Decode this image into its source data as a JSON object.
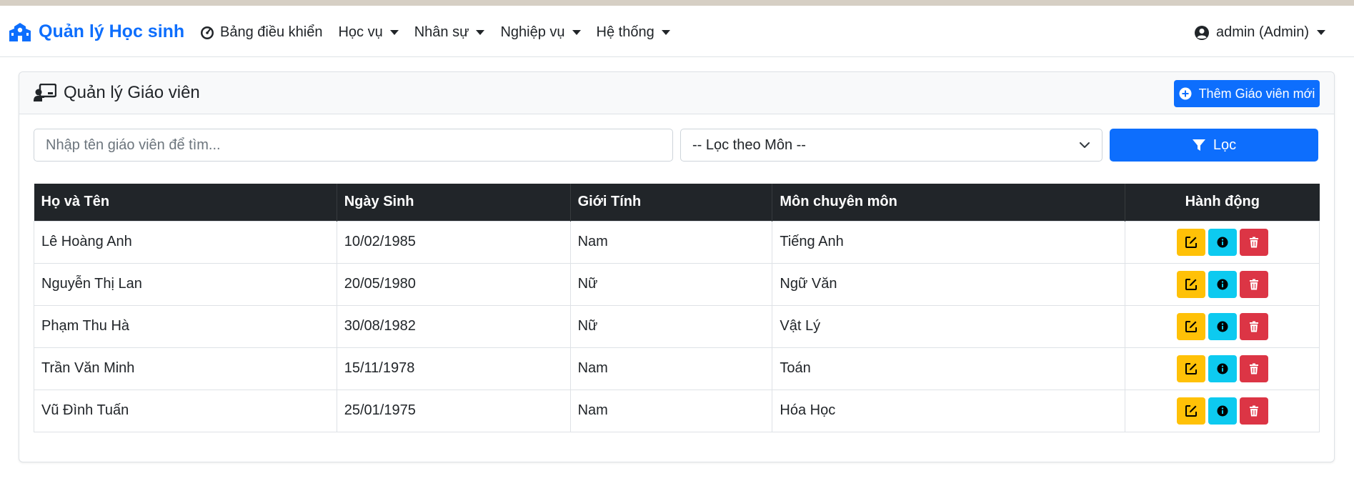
{
  "brand": {
    "title": "Quản lý Học sinh"
  },
  "nav": {
    "dashboard": "Bảng điều khiển",
    "items": [
      "Học vụ",
      "Nhân sự",
      "Nghiệp vụ",
      "Hệ thống"
    ],
    "user": "admin (Admin)"
  },
  "card": {
    "title": "Quản lý Giáo viên",
    "add_button": "Thêm Giáo viên mới"
  },
  "filters": {
    "search_placeholder": "Nhập tên giáo viên để tìm...",
    "search_value": "",
    "subject_select": "-- Lọc theo Môn --",
    "filter_button": "Lọc"
  },
  "table": {
    "headers": [
      "Họ và Tên",
      "Ngày Sinh",
      "Giới Tính",
      "Môn chuyên môn",
      "Hành động"
    ],
    "rows": [
      [
        "Lê Hoàng Anh",
        "10/02/1985",
        "Nam",
        "Tiếng Anh"
      ],
      [
        "Nguyễn Thị Lan",
        "20/05/1980",
        "Nữ",
        "Ngữ Văn"
      ],
      [
        "Phạm Thu Hà",
        "30/08/1982",
        "Nữ",
        "Vật Lý"
      ],
      [
        "Trần Văn Minh",
        "15/11/1978",
        "Nam",
        "Toán"
      ],
      [
        "Vũ Đình Tuấn",
        "25/01/1975",
        "Nam",
        "Hóa Học"
      ]
    ]
  },
  "colors": {
    "primary": "#0d6efd",
    "dark": "#212529",
    "warning": "#ffc107",
    "info": "#0dcaf0",
    "danger": "#dc3545"
  },
  "icons": {
    "brand": "school-icon",
    "dashboard": "gauge-icon",
    "user": "user-circle-icon",
    "card": "teacher-board-icon",
    "add": "plus-circle-icon",
    "filter": "funnel-icon",
    "edit": "edit-icon",
    "info": "info-icon",
    "delete": "trash-icon"
  }
}
